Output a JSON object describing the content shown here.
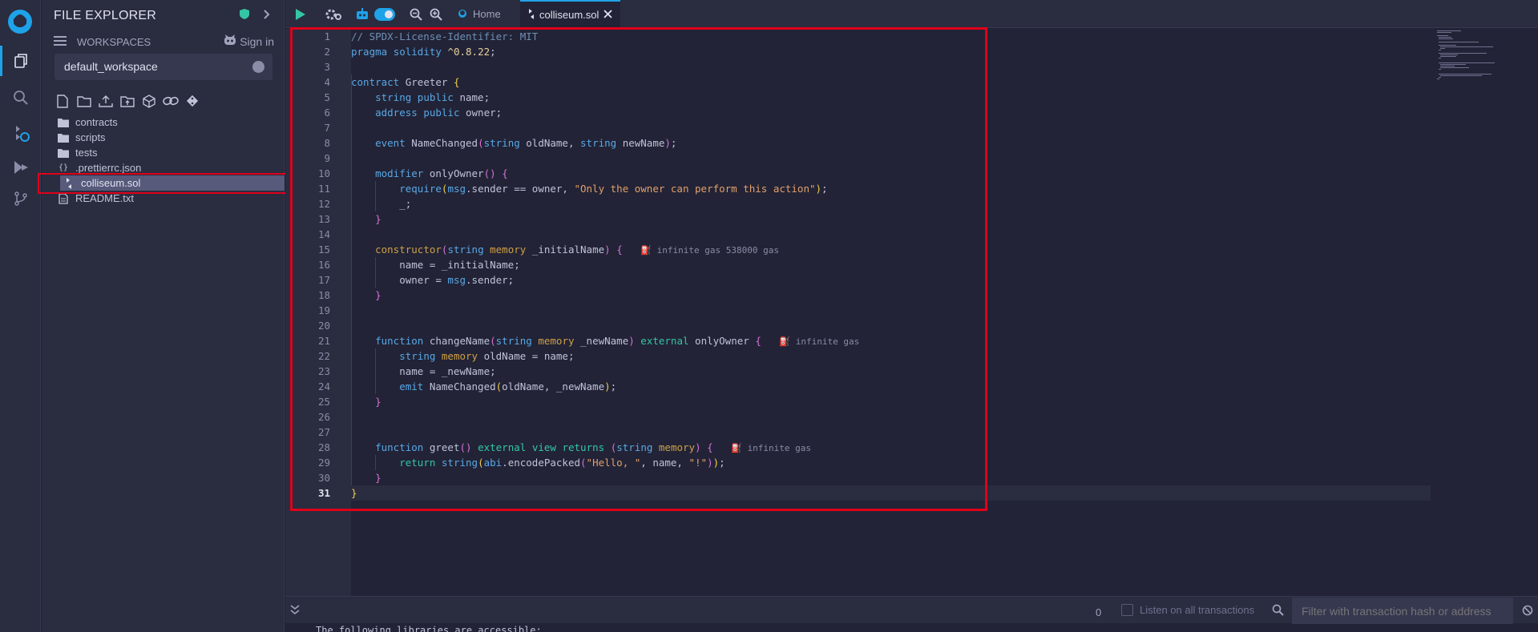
{
  "app": {
    "accent": "#1ea2e8",
    "highlight_box_color": "#e0001a"
  },
  "sidebar": {
    "title": "FILE EXPLORER",
    "workspaces_label": "WORKSPACES",
    "sign_in_label": "Sign in",
    "workspace_value": "default_workspace",
    "tree": [
      {
        "label": "contracts",
        "kind": "folder"
      },
      {
        "label": "scripts",
        "kind": "folder"
      },
      {
        "label": "tests",
        "kind": "folder"
      },
      {
        "label": ".prettierrc.json",
        "kind": "json"
      },
      {
        "label": "colliseum.sol",
        "kind": "sol",
        "selected": true
      },
      {
        "label": "README.txt",
        "kind": "txt"
      }
    ]
  },
  "tabs": [
    {
      "label": "Home",
      "icon": "remix-logo-icon"
    },
    {
      "label": "colliseum.sol",
      "icon": "solidity-icon",
      "active": true
    }
  ],
  "editor": {
    "line_count": 31,
    "current_line": 31,
    "gas_hints": {
      "constructor": "infinite gas 538000 gas",
      "changeName": "infinite gas",
      "greet": "infinite gas"
    }
  },
  "terminal": {
    "count": "0",
    "listen_label": "Listen on all transactions",
    "filter_placeholder": "Filter with transaction hash or address",
    "partial_line": "The following libraries are accessible:"
  }
}
